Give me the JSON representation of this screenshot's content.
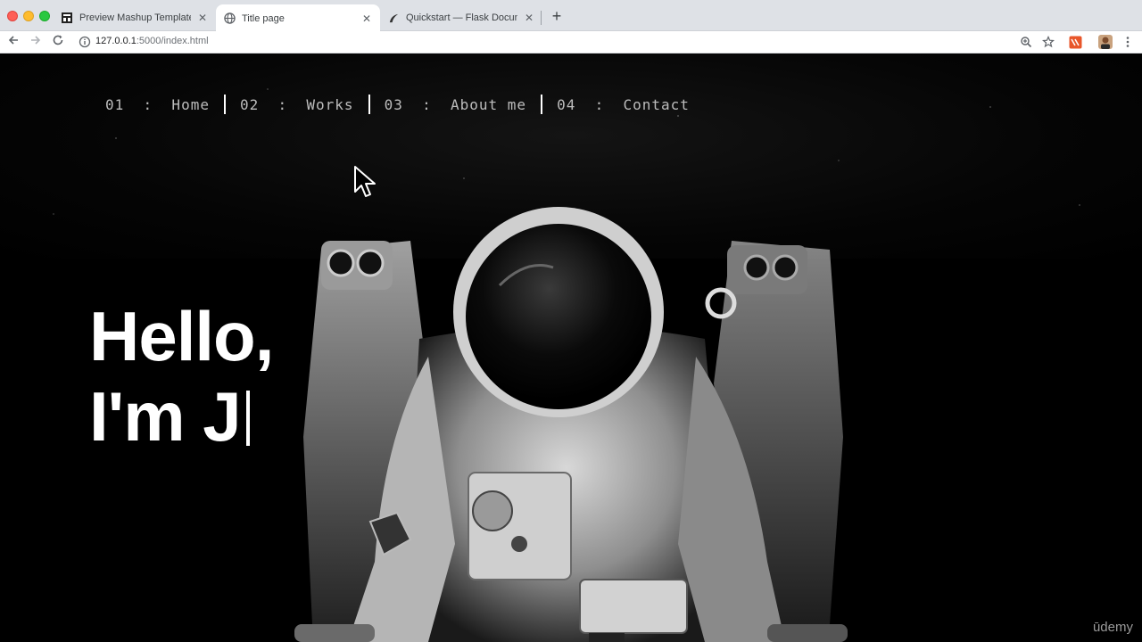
{
  "browser": {
    "tabs": [
      {
        "title": "Preview Mashup Template in d",
        "active": false,
        "favicon": "template-favicon"
      },
      {
        "title": "Title page",
        "active": true,
        "favicon": "globe-icon"
      },
      {
        "title": "Quickstart — Flask Documenta",
        "active": false,
        "favicon": "flask-horn-icon"
      }
    ],
    "new_tab_label": "+",
    "close_glyph": "✕",
    "url_host": "127.0.0.1",
    "url_rest": ":5000/index.html",
    "icons": [
      "back-arrow-icon",
      "forward-arrow-icon",
      "reload-icon",
      "info-icon",
      "zoom-icon",
      "bookmark-star-icon",
      "extension-icon",
      "profile-avatar-icon",
      "more-vert-icon"
    ]
  },
  "page": {
    "nav": [
      {
        "label": "01  :  Home"
      },
      {
        "label": "02  :  Works"
      },
      {
        "label": "03  :  About me"
      },
      {
        "label": "04  :  Contact"
      }
    ],
    "hero_line1": "Hello,",
    "hero_line2": "I'm J",
    "watermark": "ūdemy"
  },
  "colors": {
    "background": "#000000",
    "nav_text": "#bdbdbd",
    "hero_text": "#ffffff",
    "tab_strip": "#dee1e6"
  }
}
